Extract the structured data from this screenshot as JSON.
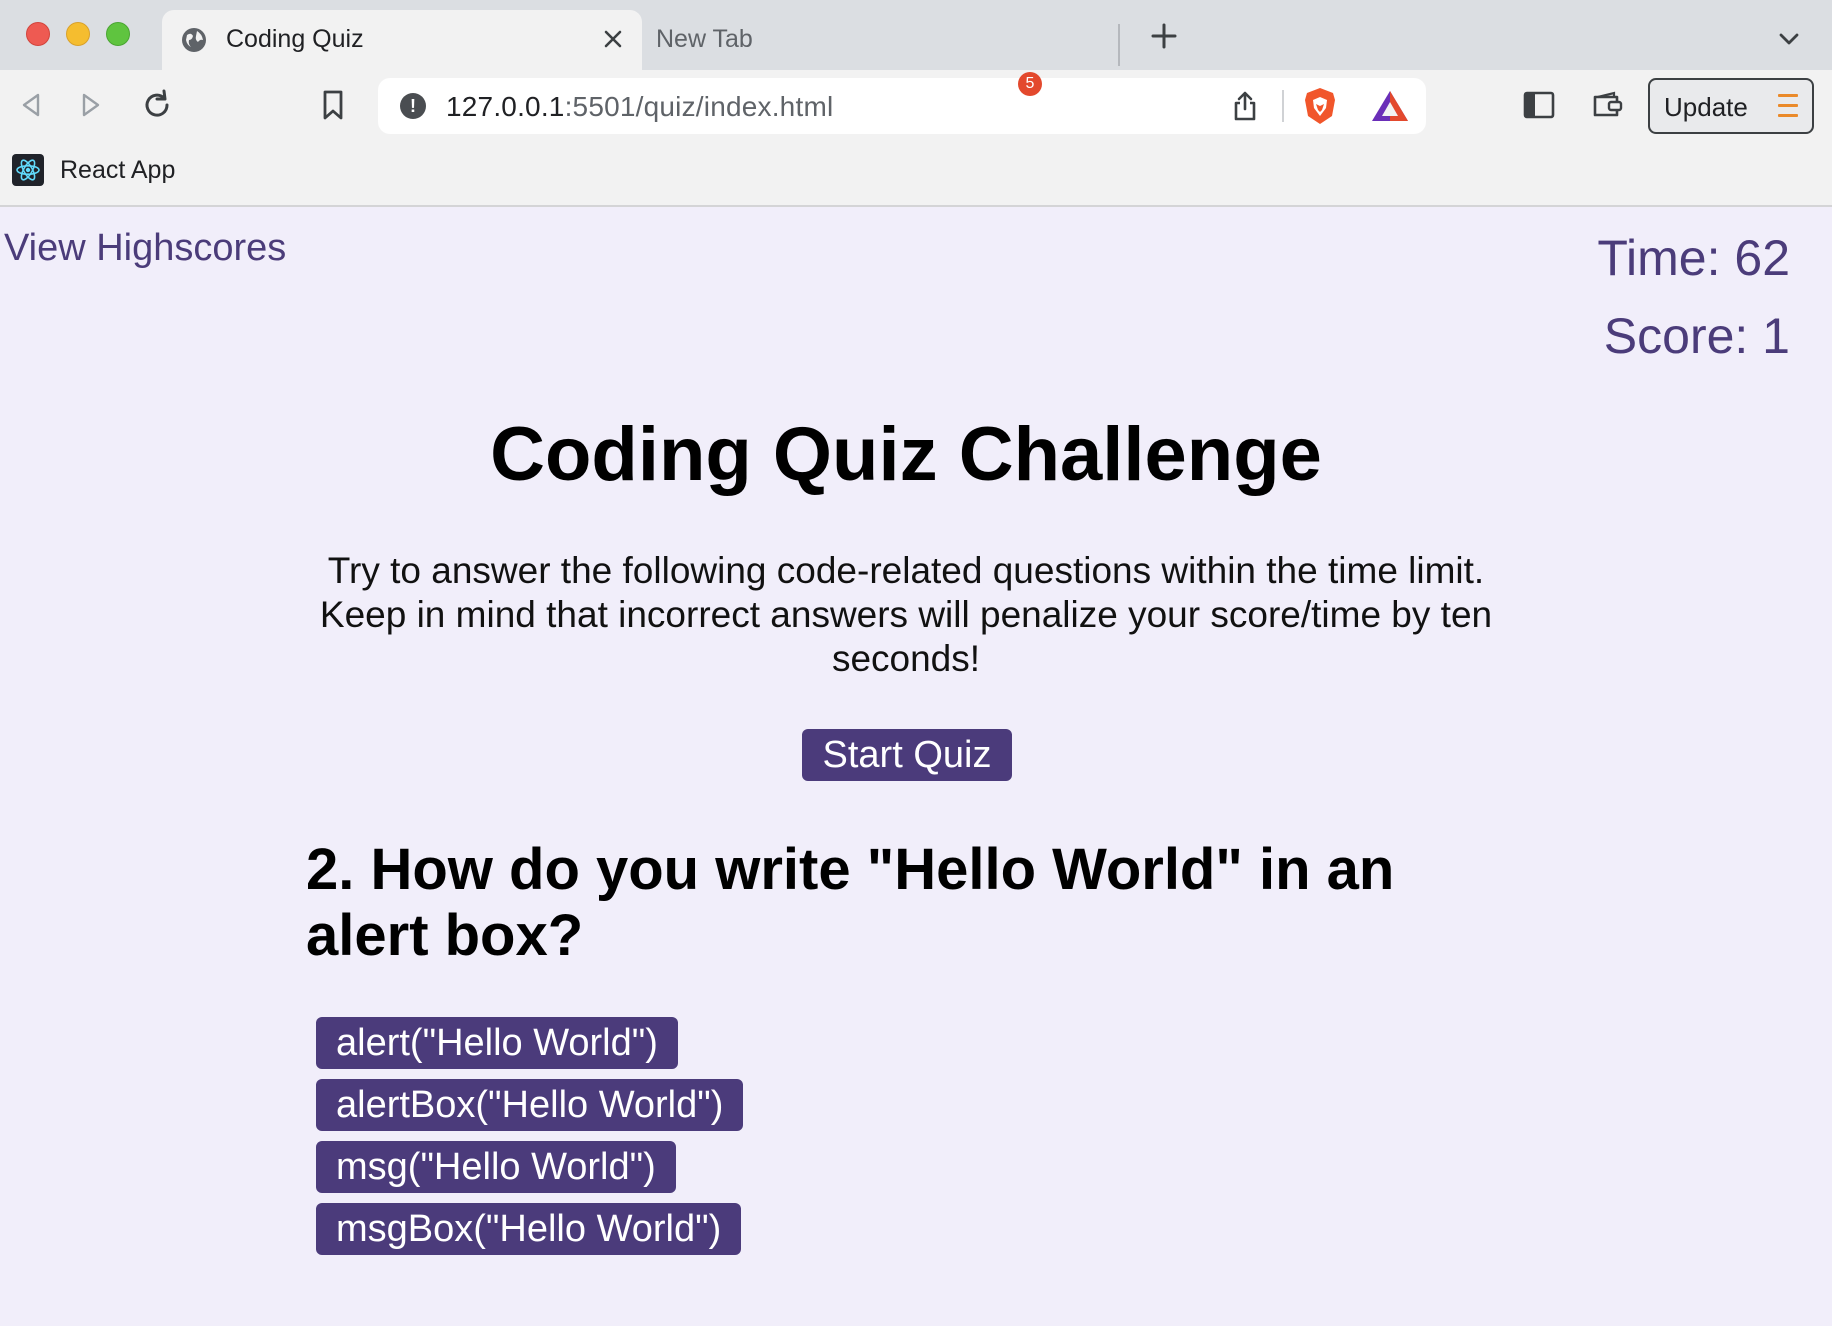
{
  "browser": {
    "tabs": [
      {
        "title": "Coding Quiz",
        "active": true
      },
      {
        "title": "New Tab",
        "active": false
      }
    ],
    "url": {
      "host": "127.0.0.1",
      "rest": ":5501/quiz/index.html"
    },
    "rewards_badge": "5",
    "update_label": "Update",
    "bookmarks": [
      {
        "label": "React App"
      }
    ]
  },
  "page": {
    "highscores_link": "View Highscores",
    "time_label": "Time: 62",
    "score_label": "Score: 1",
    "title": "Coding Quiz Challenge",
    "intro": "Try to answer the following code-related questions within the time limit. Keep in mind that incorrect answers will penalize your score/time by ten seconds!",
    "start_button": "Start Quiz",
    "question": "2. How do you write \"Hello World\" in an alert box?",
    "answers": [
      "alert(\"Hello World\")",
      "alertBox(\"Hello World\")",
      "msg(\"Hello World\")",
      "msgBox(\"Hello World\")"
    ]
  },
  "colors": {
    "accent": "#4b3b7b",
    "page_background": "#f1eefa",
    "link_text": "#4b3c7a"
  }
}
